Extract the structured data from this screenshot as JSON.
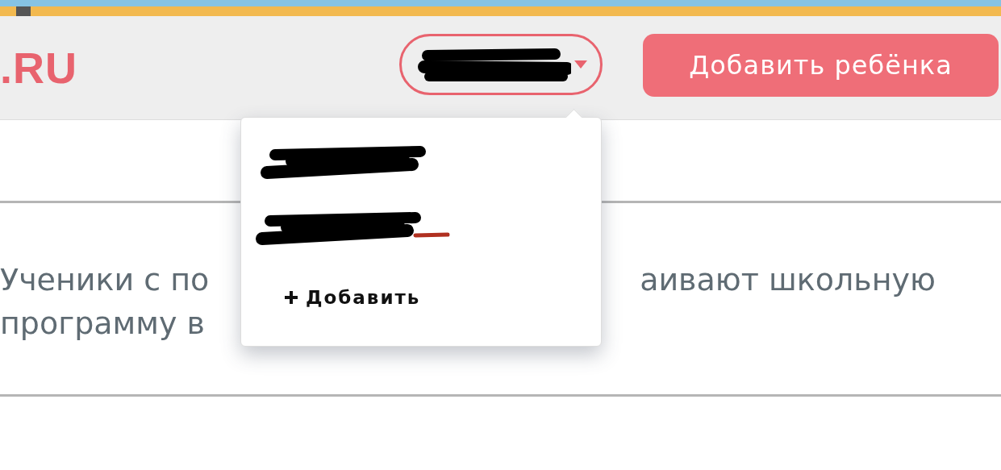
{
  "header": {
    "logo": ".RU",
    "profile_menu": {
      "expanded": true
    },
    "add_child_button": "Добавить ребёнка"
  },
  "dropdown": {
    "items": [
      {
        "kind": "redacted"
      },
      {
        "kind": "redacted-marked"
      }
    ],
    "add_label": "Добавить"
  },
  "intro": {
    "lines": [
      [
        "Ученики с по",
        "аивают школьную"
      ],
      [
        "программу в"
      ]
    ]
  }
}
